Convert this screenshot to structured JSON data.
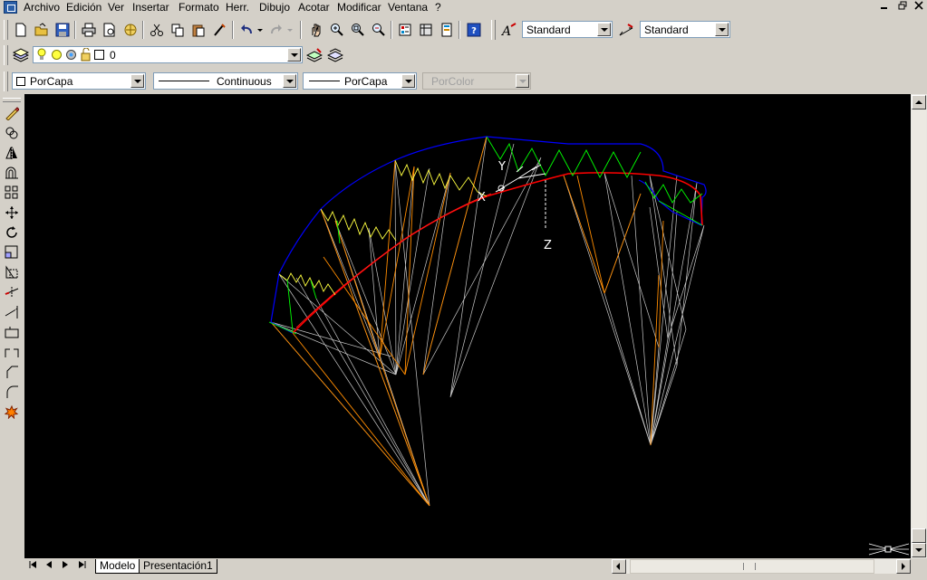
{
  "menu": {
    "items": [
      "Archivo",
      "Edición",
      "Ver",
      "Insertar",
      "Formato",
      "Herr.",
      "Dibujo",
      "Acotar",
      "Modificar",
      "Ventana",
      "?"
    ]
  },
  "styles_toolbar": {
    "text_style": "Standard",
    "dim_style": "Standard"
  },
  "layers_toolbar": {
    "current_layer": "0"
  },
  "properties_toolbar": {
    "color": "PorCapa",
    "linetype": "Continuous",
    "lineweight": "PorCapa",
    "plotstyle": "PorColor"
  },
  "canvas": {
    "ucs_x": "X",
    "ucs_y": "Y",
    "ucs_z": "Z",
    "background": "#000000"
  },
  "tabs": {
    "model": "Modelo",
    "layout": "Presentación1"
  },
  "icons": {
    "left_toolbar": [
      "erase-icon",
      "copy-icon",
      "mirror-icon",
      "offset-icon",
      "array-icon",
      "move-icon",
      "rotate-icon",
      "scale-icon",
      "stretch-icon",
      "trim-icon",
      "extend-icon",
      "break-icon",
      "break-at-point-icon",
      "chamfer-icon",
      "fillet-icon",
      "explode-icon"
    ]
  },
  "colors": {
    "canopy_outline": "#0000ff",
    "main_line": "#ff0000",
    "suspension_lines": "#c8c8c8",
    "orange_lines": "#ff8c00",
    "zigzag_yellow": "#ffff40",
    "zigzag_green": "#00ff00"
  }
}
